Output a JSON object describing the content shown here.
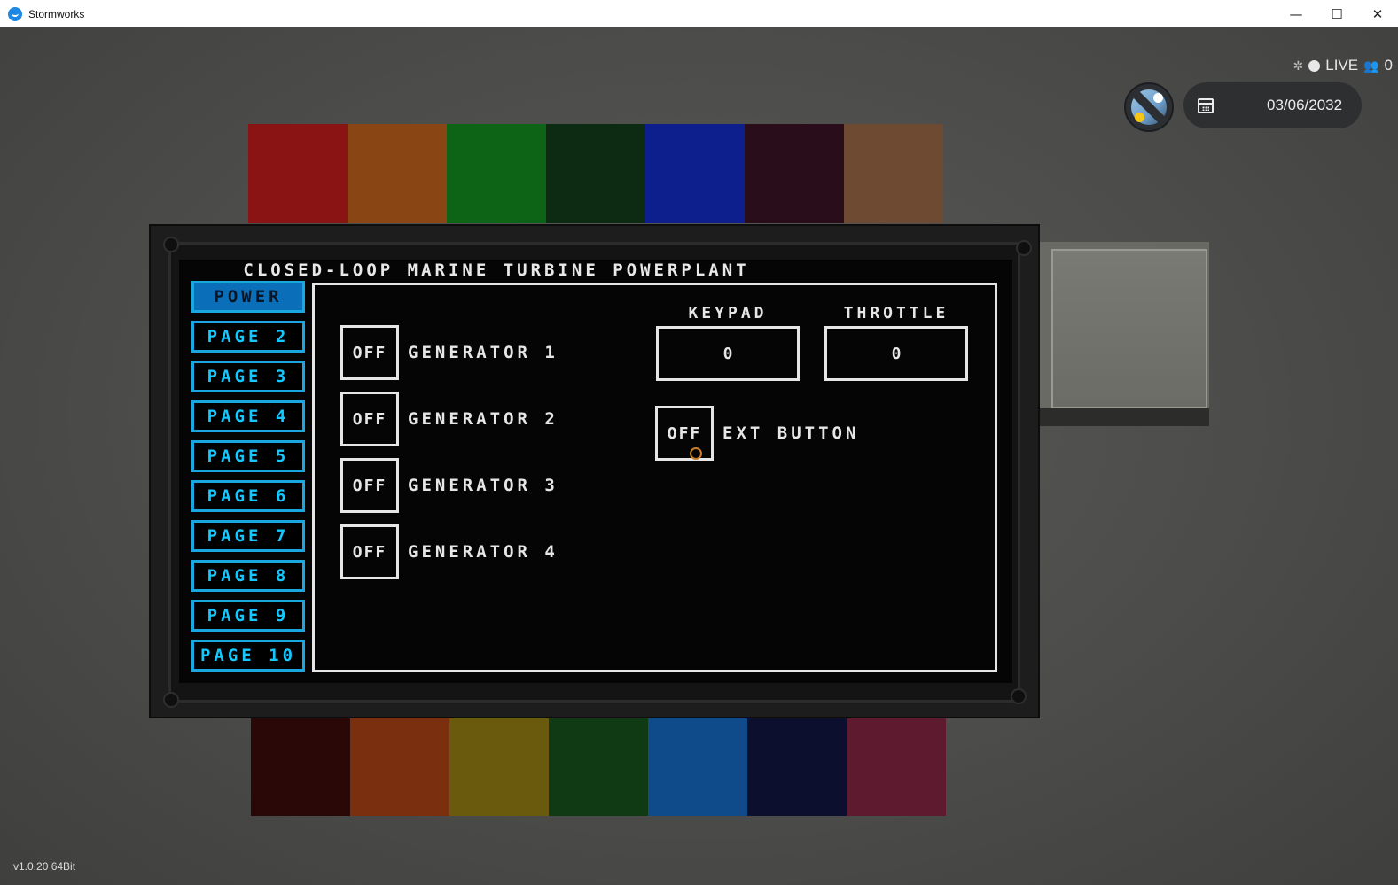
{
  "window": {
    "title": "Stormworks",
    "controls": {
      "minimize": "—",
      "maximize": "☐",
      "close": "✕"
    }
  },
  "hud": {
    "live_label": "LIVE",
    "player_count": "0",
    "date": "03/06/2032",
    "icons": [
      "bug-icon",
      "live-dot-icon",
      "players-icon",
      "weather-icon",
      "calendar-icon"
    ]
  },
  "swatches": {
    "top": [
      "#8a1414",
      "#8a4514",
      "#0d6416",
      "#0d2a12",
      "#0d1f8c",
      "#2a0d1a",
      "#6e4a32"
    ],
    "bottom": [
      "#2a0808",
      "#7a2f0e",
      "#6a5a0e",
      "#0f3a14",
      "#0f4a8a",
      "#0c0f2e",
      "#5e1a2e"
    ]
  },
  "screen": {
    "title": "CLOSED-LOOP MARINE TURBINE POWERPLANT",
    "nav": [
      "POWER",
      "PAGE 2",
      "PAGE 3",
      "PAGE 4",
      "PAGE 5",
      "PAGE 6",
      "PAGE 7",
      "PAGE 8",
      "PAGE 9",
      "PAGE 10"
    ],
    "active_nav": "POWER",
    "generators": [
      {
        "state": "OFF",
        "label": "GENERATOR 1"
      },
      {
        "state": "OFF",
        "label": "GENERATOR 2"
      },
      {
        "state": "OFF",
        "label": "GENERATOR 3"
      },
      {
        "state": "OFF",
        "label": "GENERATOR 4"
      }
    ],
    "keypad": {
      "label": "KEYPAD",
      "value": "0"
    },
    "throttle": {
      "label": "THROTTLE",
      "value": "0"
    },
    "ext_button": {
      "state": "OFF",
      "label": "EXT BUTTON"
    }
  },
  "version": "v1.0.20 64Bit",
  "colors": {
    "accent": "#14c8ff",
    "active": "#0a6fb8",
    "screen_fg": "#e6e6e6",
    "cursor": "#c87f2d"
  }
}
